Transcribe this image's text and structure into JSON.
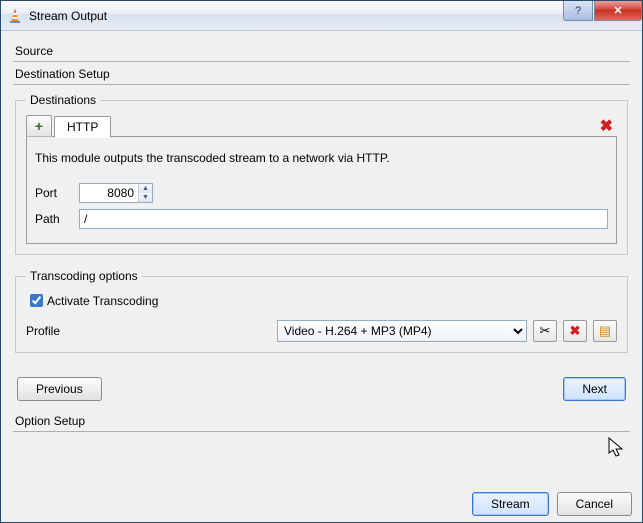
{
  "window": {
    "title": "Stream Output"
  },
  "sections": {
    "source": "Source",
    "destSetup": "Destination Setup",
    "optionSetup": "Option Setup"
  },
  "destinations": {
    "legend": "Destinations",
    "tab": "HTTP",
    "description": "This module outputs the transcoded stream to a network via HTTP.",
    "portLabel": "Port",
    "portValue": "8080",
    "pathLabel": "Path",
    "pathValue": "/"
  },
  "transcoding": {
    "legend": "Transcoding options",
    "activate": "Activate Transcoding",
    "profileLabel": "Profile",
    "profileValue": "Video - H.264 + MP3 (MP4)"
  },
  "buttons": {
    "previous": "Previous",
    "next": "Next",
    "stream": "Stream",
    "cancel": "Cancel"
  }
}
